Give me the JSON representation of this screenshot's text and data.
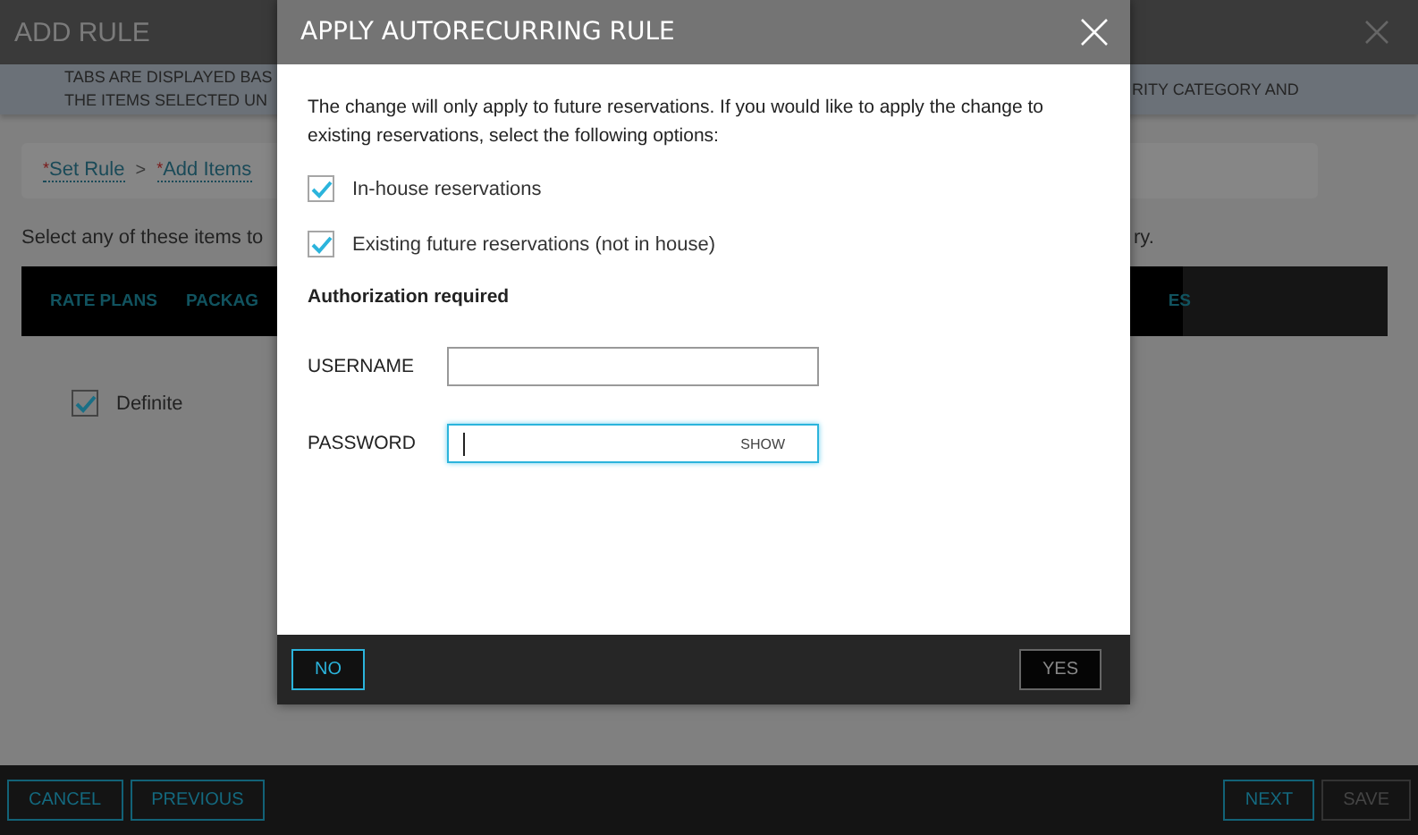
{
  "page": {
    "title": "ADD RULE",
    "notice": {
      "left_lines": [
        "TABS ARE DISPLAYED BAS",
        "THE ITEMS SELECTED UN"
      ],
      "right_lines": [
        "RITY CATEGORY AND"
      ]
    },
    "breadcrumb": [
      {
        "marker": "*",
        "label": "Set Rule"
      },
      {
        "separator": ">",
        "marker": "*",
        "label": "Add Items"
      }
    ],
    "instruction": {
      "left": "Select any of these items to",
      "right": "ry."
    },
    "tabs": [
      {
        "label": "RATE PLANS"
      },
      {
        "label": "PACKAG"
      },
      {
        "label": "ES"
      }
    ],
    "options": [
      {
        "label": "Definite",
        "checked": true
      }
    ],
    "footer": {
      "left": [
        {
          "label": "CANCEL",
          "disabled": false
        },
        {
          "label": "PREVIOUS",
          "disabled": false
        }
      ],
      "right": [
        {
          "label": "NEXT",
          "disabled": false
        },
        {
          "label": "SAVE",
          "disabled": true
        }
      ]
    }
  },
  "dialog": {
    "title": "APPLY AUTORECURRING RULE",
    "message": "The change will only apply to future reservations. If you would like to apply the change to existing reservations, select the following options:",
    "options": [
      {
        "label": "In-house reservations",
        "checked": true
      },
      {
        "label": "Existing future reservations (not in house)",
        "checked": true
      }
    ],
    "auth_heading": "Authorization required",
    "fields": [
      {
        "label": "USERNAME",
        "focused": false
      },
      {
        "label": "PASSWORD",
        "focused": true,
        "toggle": "SHOW"
      }
    ],
    "buttons": [
      {
        "label": "NO",
        "primary": true
      },
      {
        "label": "YES",
        "primary": false
      }
    ]
  }
}
